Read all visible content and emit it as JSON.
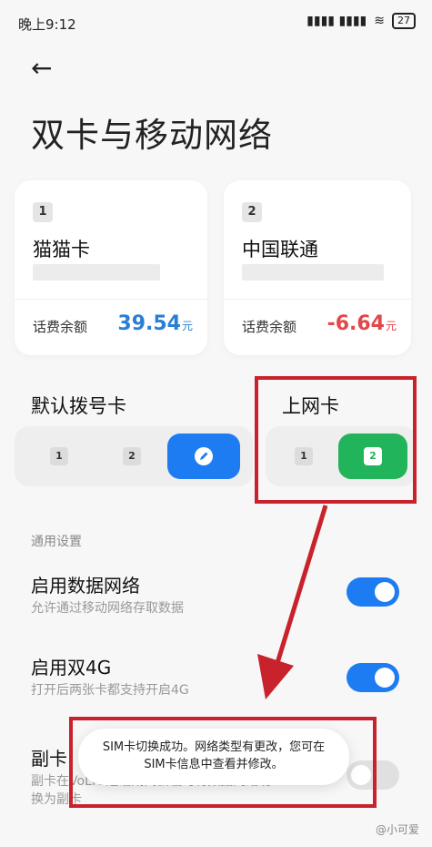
{
  "status_bar": {
    "time": "晚上9:12",
    "signal": "▮▮▮▮ ▮▮▮▮",
    "wifi": "≋",
    "battery": "27"
  },
  "header": {
    "back_glyph": "←",
    "title": "双卡与移动网络"
  },
  "sims": [
    {
      "number": "1",
      "name": "猫猫卡",
      "balance_label": "话费余额",
      "balance": "39.54",
      "unit": "元",
      "balance_color": "#2a7fd4"
    },
    {
      "number": "2",
      "name": "中国联通",
      "balance_label": "话费余额",
      "balance": "-6.64",
      "unit": "元",
      "balance_color": "#e2474b"
    }
  ],
  "default_dial": {
    "label": "默认拨号卡",
    "options": [
      "1",
      "2"
    ],
    "selected": "edit"
  },
  "data_sim": {
    "label": "上网卡",
    "options": [
      "1",
      "2"
    ],
    "selected": "2"
  },
  "general": {
    "label": "通用设置"
  },
  "settings": [
    {
      "title": "启用数据网络",
      "subtitle": "允许通过移动网络存取数据",
      "on": true
    },
    {
      "title": "启用双4G",
      "subtitle": "打开后两张卡都支持开启4G",
      "on": true
    },
    {
      "title": "副卡",
      "subtitle_line1": "副卡在VoLTE通话期间会临时将数据网络切",
      "subtitle_line2": "换为副卡",
      "on": false
    }
  ],
  "toast": {
    "line1": "SIM卡切换成功。网络类型有更改，您可在",
    "line2": "SIM卡信息中查看并修改。"
  },
  "watermark": "@小可爱",
  "colors": {
    "accent_blue": "#1e7cf2",
    "green": "#22b45a",
    "annotation_red": "#c8232c"
  }
}
